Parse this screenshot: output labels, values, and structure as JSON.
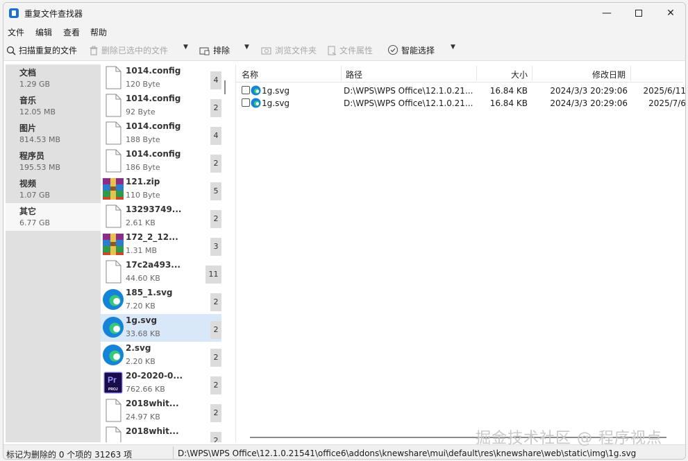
{
  "window": {
    "title": "重复文件查找器"
  },
  "menu": [
    "文件",
    "编辑",
    "查看",
    "帮助"
  ],
  "toolbar": {
    "scan": "扫描重复的文件",
    "delete": "删除已选中的文件",
    "exclude": "排除",
    "browse": "浏览文件夹",
    "props": "文件属性",
    "smart": "智能选择"
  },
  "categories": [
    {
      "name": "文档",
      "size": "1.29 GB"
    },
    {
      "name": "音乐",
      "size": "12.05 MB"
    },
    {
      "name": "图片",
      "size": "814.53 MB"
    },
    {
      "name": "程序员",
      "size": "195.53 MB"
    },
    {
      "name": "视频",
      "size": "1.07 GB"
    },
    {
      "name": "其它",
      "size": "6.77 GB"
    }
  ],
  "files": [
    {
      "name": "1014.config",
      "size": "120 Byte",
      "count": "4",
      "icon": "document-icon"
    },
    {
      "name": "1014.config",
      "size": "92 Byte",
      "count": "2",
      "icon": "document-icon"
    },
    {
      "name": "1014.config",
      "size": "188 Byte",
      "count": "4",
      "icon": "document-icon"
    },
    {
      "name": "1014.config",
      "size": "186 Byte",
      "count": "2",
      "icon": "document-icon"
    },
    {
      "name": "121.zip",
      "size": "110 Byte",
      "count": "5",
      "icon": "winrar-archive-icon"
    },
    {
      "name": "13293749...",
      "size": "2.61 KB",
      "count": "2",
      "icon": "document-icon"
    },
    {
      "name": "172_2_12...",
      "size": "1.31 MB",
      "count": "3",
      "icon": "winrar-archive-icon"
    },
    {
      "name": "17c2a493...",
      "size": "44.60 KB",
      "count": "11",
      "icon": "document-icon"
    },
    {
      "name": "185_1.svg",
      "size": "7.20 KB",
      "count": "2",
      "icon": "edge-icon"
    },
    {
      "name": "1g.svg",
      "size": "33.68 KB",
      "count": "2",
      "icon": "edge-icon"
    },
    {
      "name": "2.svg",
      "size": "2.20 KB",
      "count": "2",
      "icon": "edge-icon"
    },
    {
      "name": "20-2020-0...",
      "size": "762.66 KB",
      "count": "2",
      "icon": "premiere-project-icon"
    },
    {
      "name": "2018whit...",
      "size": "24.97 KB",
      "count": "2",
      "icon": "document-icon"
    },
    {
      "name": "2018whit...",
      "size": "",
      "count": "2",
      "icon": "document-icon"
    }
  ],
  "icon_text": {
    "premiere": "Pr",
    "proj": "PROJ"
  },
  "detail": {
    "headers": {
      "name": "名称",
      "path": "路径",
      "size": "大小",
      "modified": "修改日期"
    },
    "rows": [
      {
        "name": "1g.svg",
        "path": "D:\\WPS\\WPS Office\\12.1.0.21...",
        "size": "16.84 KB",
        "modified": "2024/3/3 20:29:06",
        "extra": "2025/6/11"
      },
      {
        "name": "1g.svg",
        "path": "D:\\WPS\\WPS Office\\12.1.0.21...",
        "size": "16.84 KB",
        "modified": "2024/3/3 20:29:06",
        "extra": "2025/7/6"
      }
    ]
  },
  "status": {
    "left": "标记为删除的 0 个项的 31263 项",
    "right": "D:\\WPS\\WPS Office\\12.1.0.21541\\office6\\addons\\knewshare\\mui\\default\\res\\knewshare\\web\\static\\img\\1g.svg"
  },
  "watermark": "掘金技术社区 @ 程序视点",
  "colors": {
    "accent": "#1b6fd1",
    "selected_row": "#d8e8f8",
    "category_bg": "#e0e0e0",
    "count_bg": "#dcdcdc"
  }
}
